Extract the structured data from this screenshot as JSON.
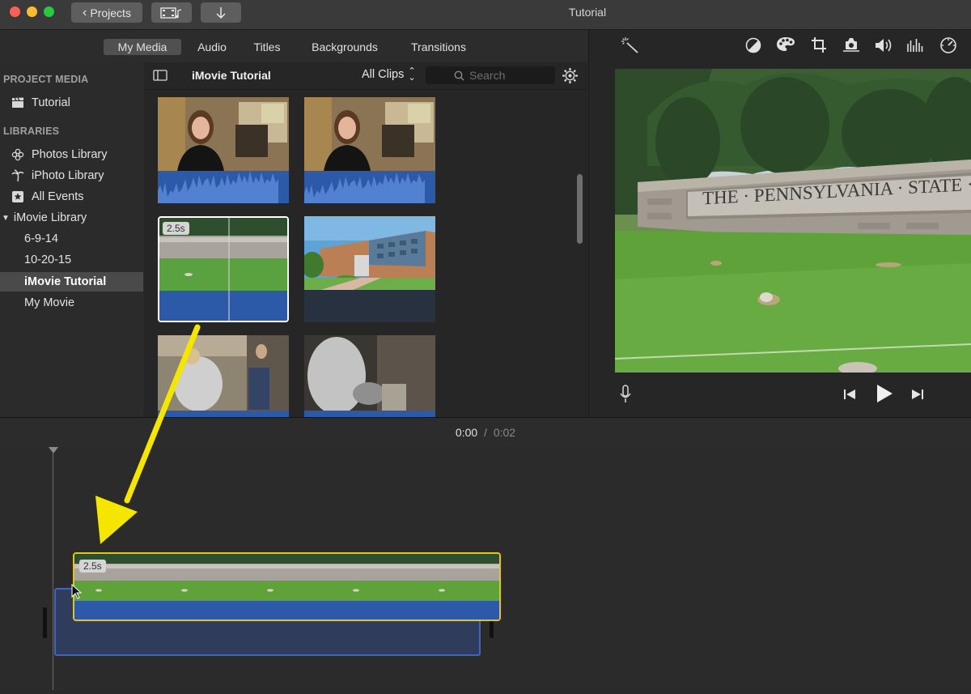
{
  "window": {
    "title": "Tutorial"
  },
  "toolbar": {
    "projects_label": "Projects"
  },
  "browser_tabs": [
    {
      "label": "My Media",
      "active": true
    },
    {
      "label": "Audio",
      "active": false
    },
    {
      "label": "Titles",
      "active": false
    },
    {
      "label": "Backgrounds",
      "active": false
    },
    {
      "label": "Transitions",
      "active": false
    }
  ],
  "sidebar": {
    "project_media_heading": "PROJECT MEDIA",
    "project_item": "Tutorial",
    "libraries_heading": "LIBRARIES",
    "items": [
      {
        "label": "Photos Library",
        "icon": "flower-icon"
      },
      {
        "label": "iPhoto Library",
        "icon": "palm-tree-icon"
      },
      {
        "label": "All Events",
        "icon": "star-icon"
      },
      {
        "label": "iMovie Library",
        "icon": "disclosure-triangle-icon"
      },
      {
        "label": "6-9-14"
      },
      {
        "label": "10-20-15"
      },
      {
        "label": "iMovie Tutorial",
        "selected": true
      },
      {
        "label": "My Movie"
      }
    ]
  },
  "media_toolbar": {
    "event_title": "iMovie Tutorial",
    "filter_label": "All Clips",
    "search_placeholder": "Search"
  },
  "clips": {
    "selected_duration": "2.5s"
  },
  "timeline": {
    "current_time": "0:00",
    "separator": "/",
    "total_time": "0:02",
    "clip_duration": "2.5s"
  },
  "colors": {
    "accent_yellow": "#f5e600",
    "audio_blue": "#2d5aa8",
    "selection_yellow": "#e8c21a"
  }
}
